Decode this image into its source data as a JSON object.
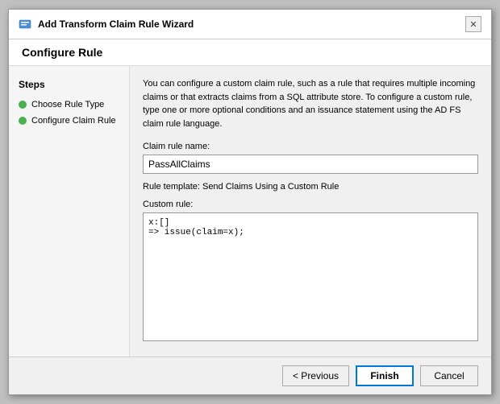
{
  "dialog": {
    "title": "Add Transform Claim Rule Wizard",
    "section_header": "Configure Rule"
  },
  "sidebar": {
    "title": "Steps",
    "items": [
      {
        "id": "choose-rule-type",
        "label": "Choose Rule Type",
        "active": true
      },
      {
        "id": "configure-claim-rule",
        "label": "Configure Claim Rule",
        "active": true
      }
    ]
  },
  "main": {
    "description": "You can configure a custom claim rule, such as a rule that requires multiple incoming claims or that extracts claims from a SQL attribute store. To configure a custom rule, type one or more optional conditions and an issuance statement using the AD FS claim rule language.",
    "claim_rule_name_label": "Claim rule name:",
    "claim_rule_name_value": "PassAllClaims",
    "rule_template_text": "Rule template: Send Claims Using a Custom Rule",
    "custom_rule_label": "Custom rule:",
    "custom_rule_value": "x:[]\n=> issue(claim=x);"
  },
  "footer": {
    "previous_label": "< Previous",
    "finish_label": "Finish",
    "cancel_label": "Cancel"
  },
  "icons": {
    "close": "✕",
    "wizard": "🔧"
  }
}
